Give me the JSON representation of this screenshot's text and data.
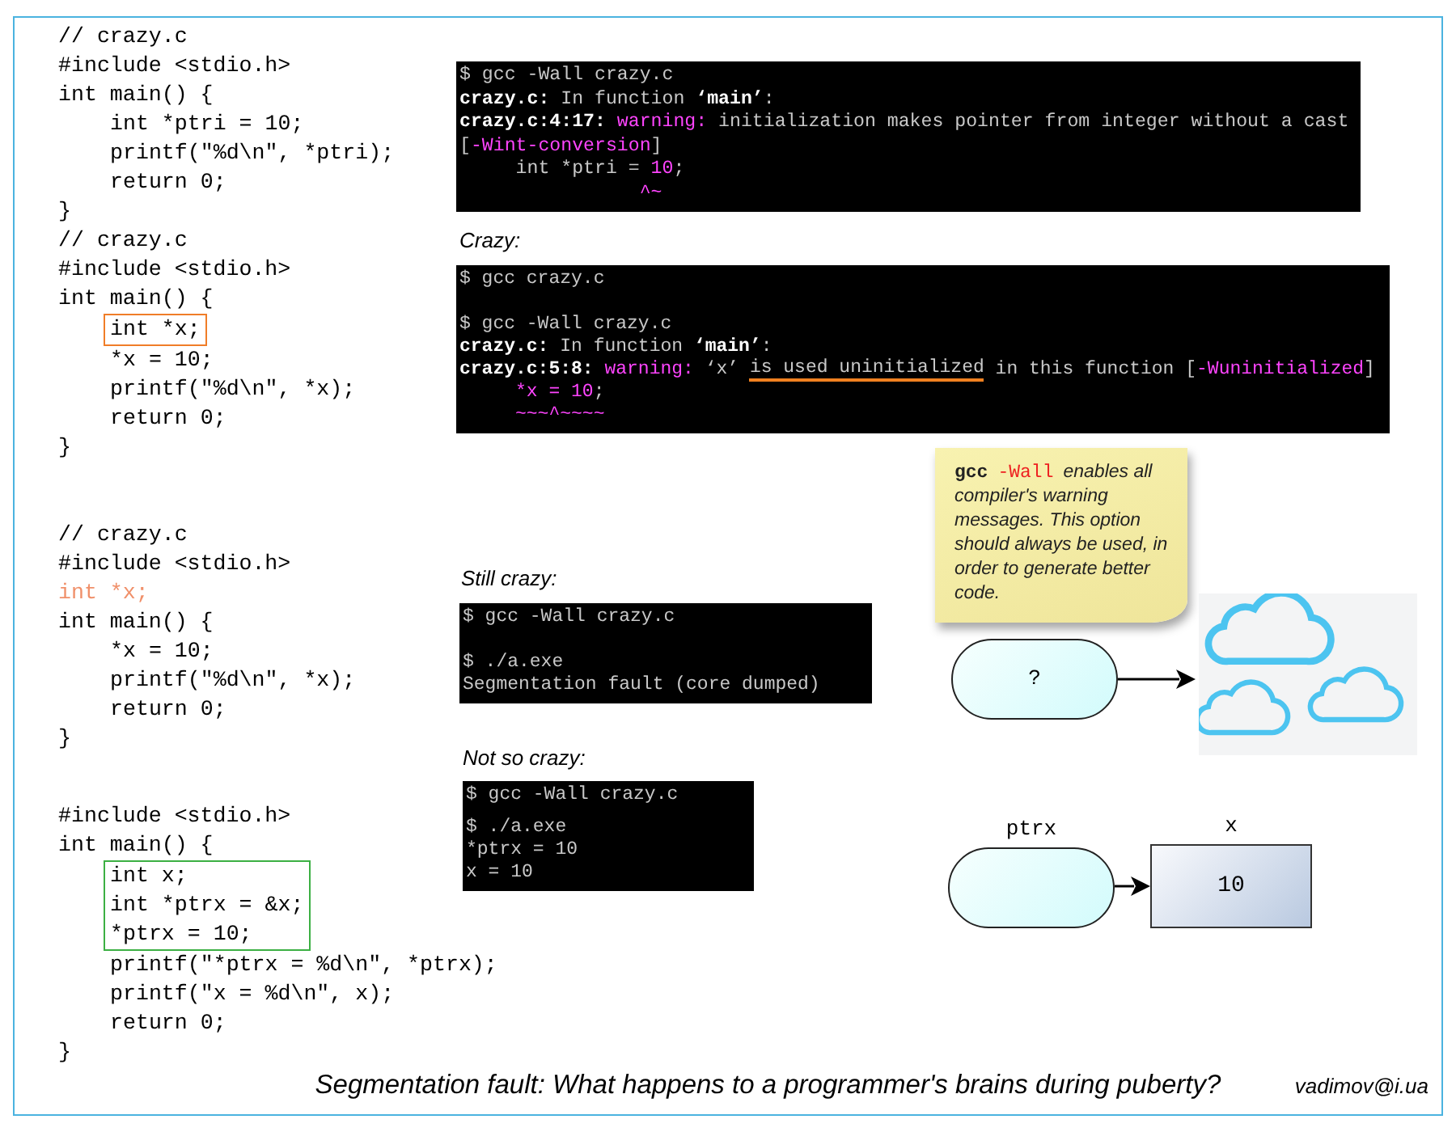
{
  "listings": [
    {
      "lines": [
        {
          "kind": "line",
          "text": "// crazy.c"
        },
        {
          "kind": "line",
          "text": "#include <stdio.h>"
        },
        {
          "kind": "line",
          "text": "int main() {",
          "children": [
            {
              "kind": "line",
              "text": "int *ptri = 10;"
            },
            {
              "kind": "line",
              "text": "printf(\"%d\\n\", *ptri);"
            },
            {
              "kind": "line",
              "text": "return 0;"
            }
          ]
        },
        {
          "kind": "line",
          "text": "}"
        }
      ]
    },
    {
      "lines": [
        {
          "kind": "line",
          "text": "// crazy.c"
        },
        {
          "kind": "line",
          "text": "#include <stdio.h>"
        },
        {
          "kind": "line",
          "text": "int main() {",
          "children": [
            {
              "kind": "boxed",
              "color": "#f07d28",
              "lines": [
                {
                  "kind": "line",
                  "text": "int *x;"
                }
              ]
            },
            {
              "kind": "line",
              "text": "*x = 10;"
            },
            {
              "kind": "line",
              "text": "printf(\"%d\\n\", *x);"
            },
            {
              "kind": "line",
              "text": "return 0;"
            }
          ]
        },
        {
          "kind": "line",
          "text": "}"
        }
      ]
    },
    {
      "lines": [
        {
          "kind": "line",
          "text": "// crazy.c"
        },
        {
          "kind": "line",
          "text": "#include <stdio.h>"
        },
        {
          "kind": "line",
          "text": "int *x;",
          "color": "#f0906a"
        },
        {
          "kind": "line",
          "text": "int main() {",
          "children": [
            {
              "kind": "line",
              "text": "*x = 10;"
            },
            {
              "kind": "line",
              "text": "printf(\"%d\\n\", *x);"
            },
            {
              "kind": "line",
              "text": "return 0;"
            }
          ]
        },
        {
          "kind": "line",
          "text": "}"
        }
      ]
    },
    {
      "lines": [
        {
          "kind": "line",
          "text": "#include <stdio.h>"
        },
        {
          "kind": "line",
          "text": "int main() {",
          "children": [
            {
              "kind": "boxed",
              "color": "#3cb043",
              "lines": [
                {
                  "kind": "line",
                  "text": "int x;"
                },
                {
                  "kind": "line",
                  "text": "int *ptrx = &x;"
                },
                {
                  "kind": "line",
                  "text": "*ptrx = 10;"
                }
              ]
            },
            {
              "kind": "line",
              "text": "printf(\"*ptrx = %d\\n\", *ptrx);"
            },
            {
              "kind": "line",
              "text": "printf(\"x = %d\\n\", x);"
            },
            {
              "kind": "line",
              "text": "return 0;"
            }
          ]
        },
        {
          "kind": "line",
          "text": "}"
        }
      ]
    }
  ],
  "terminals": [
    {
      "lines": [
        {
          "kind": "text",
          "segments": [
            {
              "text": "$ gcc -Wall crazy.c",
              "kind": "plain"
            }
          ]
        },
        {
          "kind": "text",
          "segments": [
            {
              "text": "crazy.c:",
              "kind": "bold"
            },
            {
              "text": " In function ",
              "kind": "plain"
            },
            {
              "text": "‘main’",
              "kind": "bold"
            },
            {
              "text": ":",
              "kind": "plain"
            }
          ]
        },
        {
          "kind": "text",
          "segments": [
            {
              "text": "crazy.c:4:17: ",
              "kind": "bold"
            },
            {
              "text": "warning:",
              "kind": "magenta"
            },
            {
              "text": " initialization makes pointer from integer without a cast",
              "kind": "plain"
            }
          ]
        },
        {
          "kind": "text",
          "segments": [
            {
              "text": "[",
              "kind": "plain"
            },
            {
              "text": "-Wint-conversion",
              "kind": "magenta"
            },
            {
              "text": "]",
              "kind": "plain"
            }
          ]
        },
        {
          "kind": "text",
          "segments": [
            {
              "text": "     int *ptri = ",
              "kind": "plain"
            },
            {
              "text": "10",
              "kind": "magenta"
            },
            {
              "text": ";",
              "kind": "plain"
            }
          ]
        },
        {
          "kind": "text",
          "segments": [
            {
              "text": "                ^~",
              "kind": "magenta"
            }
          ]
        }
      ]
    },
    {
      "caption": "Crazy:",
      "lines": [
        {
          "kind": "text",
          "segments": [
            {
              "text": "$ gcc crazy.c",
              "kind": "plain"
            }
          ]
        },
        {
          "kind": "gap"
        },
        {
          "kind": "text",
          "segments": [
            {
              "text": "$ gcc -Wall crazy.c",
              "kind": "plain"
            }
          ]
        },
        {
          "kind": "text",
          "segments": [
            {
              "text": "crazy.c:",
              "kind": "bold"
            },
            {
              "text": " In function ",
              "kind": "plain"
            },
            {
              "text": "‘main’",
              "kind": "bold"
            },
            {
              "text": ":",
              "kind": "plain"
            }
          ]
        },
        {
          "kind": "text",
          "segments": [
            {
              "text": "crazy.c:5:8: ",
              "kind": "bold"
            },
            {
              "text": "warning:",
              "kind": "magenta"
            },
            {
              "text": " ‘x’ ",
              "kind": "plain"
            },
            {
              "text": "is used uninitialized",
              "kind": "plain",
              "underlined": true
            },
            {
              "text": " in this function [",
              "kind": "plain"
            },
            {
              "text": "-Wuninitialized",
              "kind": "magenta"
            },
            {
              "text": "]",
              "kind": "plain"
            }
          ]
        },
        {
          "kind": "text",
          "segments": [
            {
              "text": "     *x = 10",
              "kind": "magenta"
            },
            {
              "text": ";",
              "kind": "plain"
            }
          ]
        },
        {
          "kind": "text",
          "segments": [
            {
              "text": "     ~~~^~~~~",
              "kind": "magenta"
            }
          ]
        }
      ]
    },
    {
      "caption": "Still crazy:",
      "lines": [
        {
          "kind": "text",
          "segments": [
            {
              "text": "$ gcc -Wall crazy.c",
              "kind": "plain"
            }
          ]
        },
        {
          "kind": "gap"
        },
        {
          "kind": "text",
          "segments": [
            {
              "text": "$ ./a.exe",
              "kind": "plain"
            }
          ]
        },
        {
          "kind": "text",
          "segments": [
            {
              "text": "Segmentation fault (core dumped)",
              "kind": "plain"
            }
          ]
        }
      ]
    },
    {
      "caption": "Not so crazy:",
      "lines": [
        {
          "kind": "text",
          "segments": [
            {
              "text": "$ gcc -Wall crazy.c",
              "kind": "plain"
            }
          ]
        },
        {
          "kind": "gap"
        },
        {
          "kind": "text",
          "segments": [
            {
              "text": "$ ./a.exe",
              "kind": "plain"
            }
          ]
        },
        {
          "kind": "text",
          "segments": [
            {
              "text": "*ptrx = 10",
              "kind": "plain"
            }
          ]
        },
        {
          "kind": "text",
          "segments": [
            {
              "text": "x = 10",
              "kind": "plain"
            }
          ]
        }
      ]
    }
  ],
  "note": {
    "segments": [
      {
        "text": "gcc",
        "kind": "command"
      },
      {
        "text": "-Wall",
        "kind": "flag"
      },
      {
        "text": "enables all compiler's warning messages. This option should always be used, in order to generate better code.",
        "kind": "note"
      }
    ]
  },
  "diagrams": [
    {
      "pointer": {
        "value": "?"
      },
      "target": {
        "kind": "clouds"
      }
    },
    {
      "pointer": {
        "label": "ptrx"
      },
      "target": {
        "kind": "box",
        "label": "x",
        "value": "10"
      }
    }
  ],
  "caption": "Segmentation fault: What happens to a programmer's brains during puberty?",
  "author": "vadimov@i.ua"
}
